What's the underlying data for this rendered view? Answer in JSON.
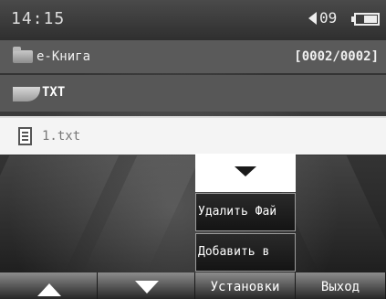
{
  "status": {
    "time": "14:15",
    "volume": "09"
  },
  "path": {
    "label": "e-Книга",
    "counter": "[0002/0002]"
  },
  "list": {
    "items": [
      {
        "label": "TXT",
        "icon": "folder-icon"
      },
      {
        "label": "1.txt",
        "icon": "text-file-icon",
        "selected": true
      }
    ]
  },
  "popup": {
    "items": [
      "Удалить Фай",
      "Добавить в"
    ]
  },
  "softkeys": {
    "settings": "Установки",
    "exit": "Выход"
  }
}
